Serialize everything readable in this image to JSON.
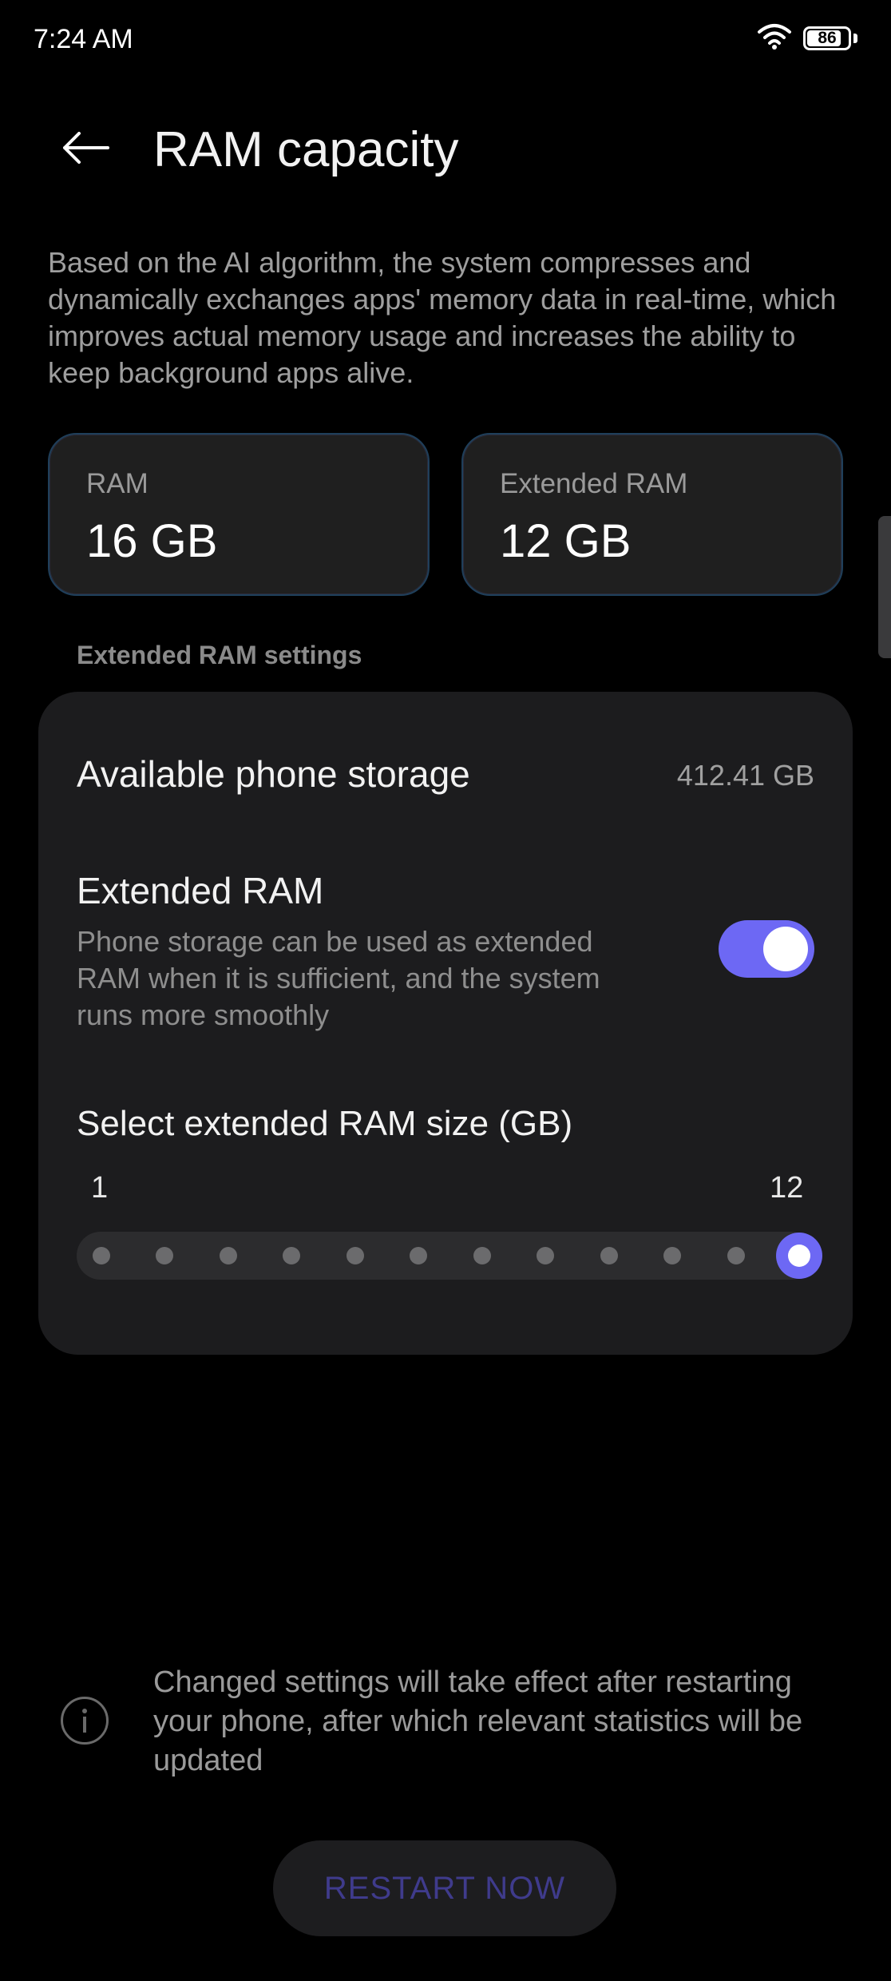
{
  "status_bar": {
    "time": "7:24 AM",
    "battery": "86",
    "battery_level": 0.86,
    "wifi_icon": "wifi-icon"
  },
  "header": {
    "back_icon": "arrow-left-icon",
    "title": "RAM capacity"
  },
  "description": "Based on the AI algorithm, the system compresses and dynamically exchanges apps' memory data in real-time, which improves actual memory usage and increases the ability to keep background apps alive.",
  "ram_cards": {
    "ram": {
      "label": "RAM",
      "value": "16 GB"
    },
    "extended": {
      "label": "Extended RAM",
      "value": "12 GB"
    }
  },
  "section_header": "Extended RAM settings",
  "settings": {
    "storage": {
      "label": "Available phone storage",
      "value": "412.41 GB"
    },
    "extended_ram": {
      "label": "Extended RAM",
      "description": "Phone storage can be used as extended RAM when it is sufficient, and the system runs more smoothly",
      "enabled": true
    },
    "size_slider": {
      "label": "Select extended RAM size (GB)",
      "min_label": "1",
      "max_label": "12",
      "min": 1,
      "max": 12,
      "value": 12
    }
  },
  "notice": {
    "icon": "info-icon",
    "text": "Changed settings will take effect after restarting your phone, after which relevant statistics will be updated"
  },
  "restart_button": "RESTART NOW",
  "colors": {
    "accent": "#6d68f4",
    "background": "#000000",
    "card": "#1c1c1e"
  }
}
